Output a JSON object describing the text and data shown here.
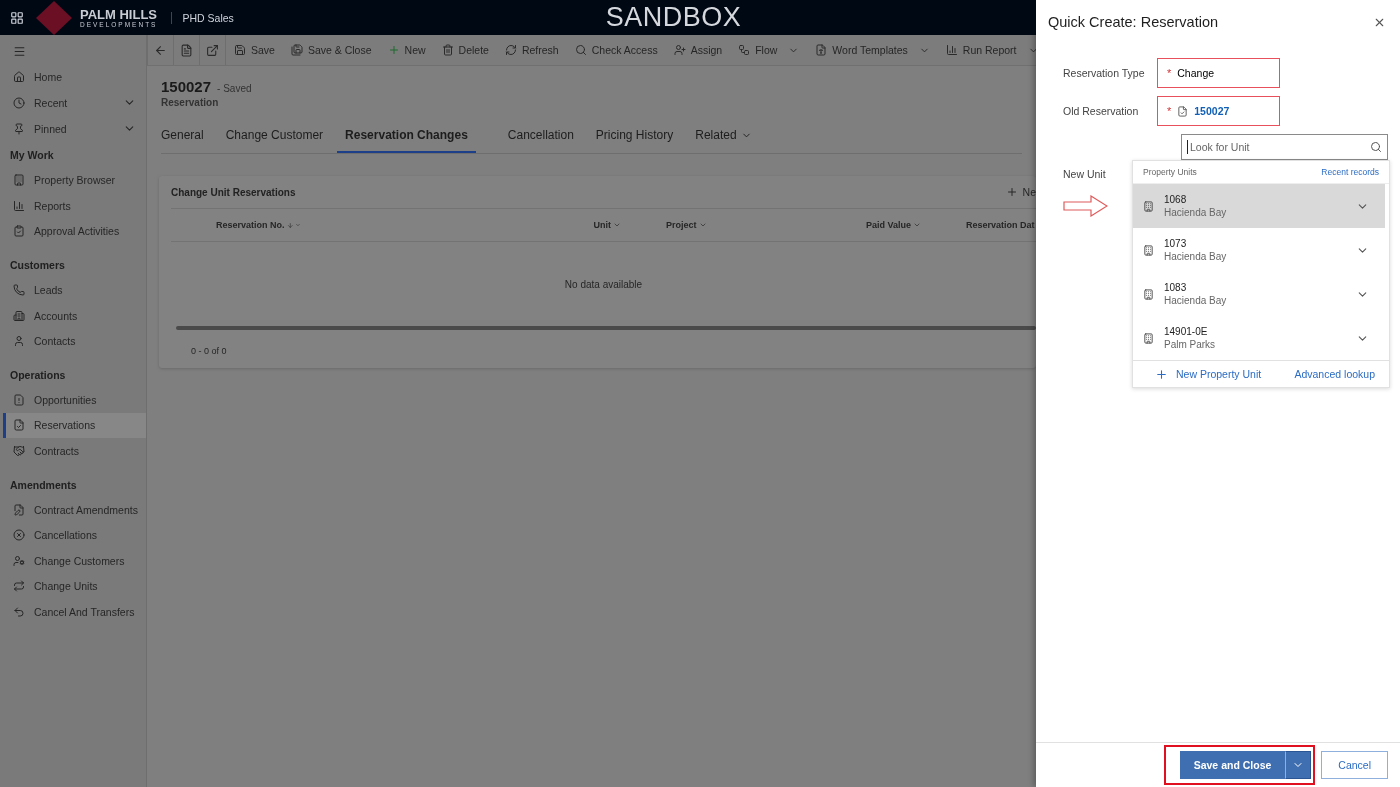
{
  "header": {
    "brand": "PALM HILLS",
    "brand_sub": "DEVELOPMENTS",
    "app": "PHD Sales",
    "environment": "SANDBOX"
  },
  "sidebar": {
    "top": [
      {
        "label": "Home",
        "expandable": false
      },
      {
        "label": "Recent",
        "expandable": true
      },
      {
        "label": "Pinned",
        "expandable": true
      }
    ],
    "groups": [
      {
        "title": "My Work",
        "items": [
          {
            "label": "Property Browser",
            "selected": false
          },
          {
            "label": "Reports",
            "selected": false
          },
          {
            "label": "Approval Activities",
            "selected": false
          }
        ]
      },
      {
        "title": "Customers",
        "items": [
          {
            "label": "Leads",
            "selected": false
          },
          {
            "label": "Accounts",
            "selected": false
          },
          {
            "label": "Contacts",
            "selected": false
          }
        ]
      },
      {
        "title": "Operations",
        "items": [
          {
            "label": "Opportunities",
            "selected": false
          },
          {
            "label": "Reservations",
            "selected": true
          },
          {
            "label": "Contracts",
            "selected": false
          }
        ]
      },
      {
        "title": "Amendments",
        "items": [
          {
            "label": "Contract Amendments",
            "selected": false
          },
          {
            "label": "Cancellations",
            "selected": false
          },
          {
            "label": "Change Customers",
            "selected": false
          },
          {
            "label": "Change Units",
            "selected": false
          },
          {
            "label": "Cancel And Transfers",
            "selected": false
          }
        ]
      }
    ]
  },
  "toolbar": [
    {
      "label": "Save",
      "has_menu": false
    },
    {
      "label": "Save & Close",
      "has_menu": false
    },
    {
      "label": "New",
      "has_menu": false
    },
    {
      "label": "Delete",
      "has_menu": false
    },
    {
      "label": "Refresh",
      "has_menu": false
    },
    {
      "label": "Check Access",
      "has_menu": false
    },
    {
      "label": "Assign",
      "has_menu": false
    },
    {
      "label": "Flow",
      "has_menu": true
    },
    {
      "label": "Word Templates",
      "has_menu": true
    },
    {
      "label": "Run Report",
      "has_menu": true
    }
  ],
  "record": {
    "title": "150027",
    "status": "- Saved",
    "entity": "Reservation"
  },
  "tabs": [
    {
      "label": "General",
      "selected": false,
      "has_menu": false
    },
    {
      "label": "Change Customer",
      "selected": false,
      "has_menu": false
    },
    {
      "label": "Reservation Changes",
      "selected": true,
      "has_menu": false
    },
    {
      "label": "Cancellation",
      "selected": false,
      "has_menu": false
    },
    {
      "label": "Pricing History",
      "selected": false,
      "has_menu": false
    },
    {
      "label": "Related",
      "selected": false,
      "has_menu": true
    }
  ],
  "grid": {
    "title": "Change Unit Reservations",
    "new_button": "Ne",
    "columns": [
      "Reservation No.",
      "Unit",
      "Project",
      "Paid Value",
      "Reservation Dat"
    ],
    "empty": "No data available",
    "count": "0 - 0 of 0"
  },
  "quick_create": {
    "title": "Quick Create: Reservation",
    "fields": [
      {
        "label": "Reservation Type",
        "value": "Change",
        "required": true,
        "kind": "text"
      },
      {
        "label": "Old Reservation",
        "value": "150027",
        "required": true,
        "kind": "lookup"
      }
    ],
    "new_unit": {
      "label": "New Unit",
      "placeholder": "Look for Unit",
      "list_title": "Property Units",
      "recent": "Recent records",
      "results": [
        {
          "name": "1068",
          "project": "Hacienda Bay",
          "selected": true
        },
        {
          "name": "1073",
          "project": "Hacienda Bay",
          "selected": false
        },
        {
          "name": "1083",
          "project": "Hacienda Bay",
          "selected": false
        },
        {
          "name": "14901-0E",
          "project": "Palm Parks",
          "selected": false
        }
      ],
      "new_record": "New Property Unit",
      "advanced": "Advanced lookup"
    },
    "required_mark": "*",
    "save": "Save and Close",
    "cancel": "Cancel"
  }
}
